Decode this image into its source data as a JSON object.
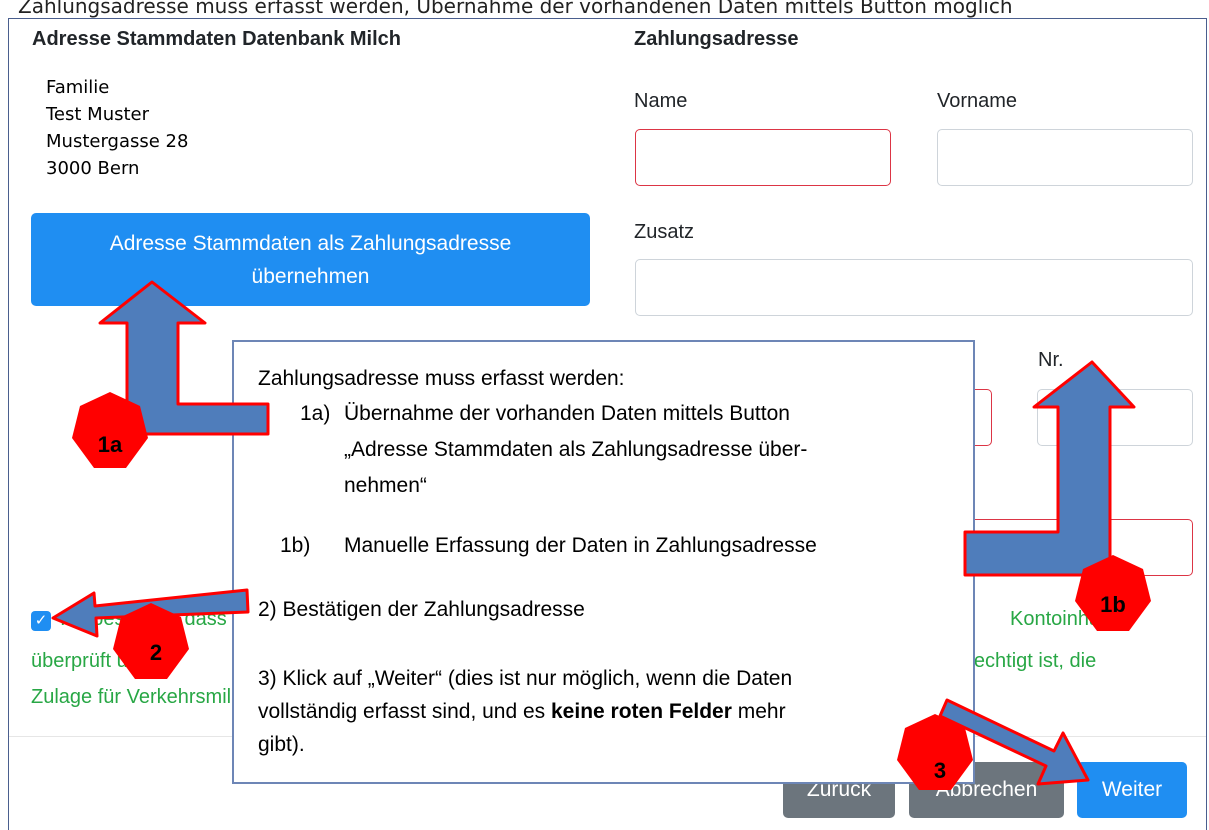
{
  "top_text": "Zahlungsadresse muss erfasst werden, Übernahme der vorhandenen Daten mittels Button möglich",
  "left": {
    "heading": "Adresse Stammdaten Datenbank Milch",
    "address_lines": [
      "Familie",
      "Test Muster",
      "Mustergasse 28",
      "3000 Bern"
    ],
    "copy_button": "Adresse Stammdaten als Zahlungsadresse übernehmen"
  },
  "right": {
    "heading": "Zahlungsadresse",
    "name_label": "Name",
    "vorname_label": "Vorname",
    "zusatz_label": "Zusatz",
    "nr_label": "Nr."
  },
  "confirm": {
    "text_fragment_1": "Ich bestätige, dass",
    "text_fragment_2": "Kontoinhaber",
    "text_line2_left": "überprüft und",
    "text_line2_right": "berechtigt ist, die",
    "text_line3": "Zulage für Verkehrsmilch"
  },
  "footer": {
    "back_button": "Zurück",
    "cancel_button": "Abbrechen",
    "next_button": "Weiter"
  },
  "callout": {
    "intro": "Zahlungsadresse muss erfasst werden:",
    "item_1a_num": "1a)",
    "item_1a_line1": "Übernahme der vorhanden Daten mittels Button",
    "item_1a_line2": "„Adresse Stammdaten als Zahlungsadresse über-",
    "item_1a_line3": "nehmen“",
    "item_1b_num": "1b)",
    "item_1b_text": "Manuelle Erfassung der Daten in Zahlungsadresse",
    "item_2": "2) Bestätigen der Zahlungsadresse",
    "item_3_line1": "3) Klick auf „Weiter“ (dies ist nur möglich, wenn die Daten",
    "item_3_line2_a": "vollständig erfasst sind, und es ",
    "item_3_line2_b": "keine roten Felder",
    "item_3_line2_c": " mehr",
    "item_3_line3": "gibt)."
  },
  "markers": {
    "m1a": "1a",
    "m1b": "1b",
    "m2": "2",
    "m3": "3"
  },
  "colors": {
    "primary": "#1f8ef2",
    "invalid_border": "#dc3545",
    "success_text": "#28a745",
    "marker_fill": "#ff0000",
    "arrow_fill": "#4f7dbb",
    "arrow_stroke": "#ff0000"
  }
}
